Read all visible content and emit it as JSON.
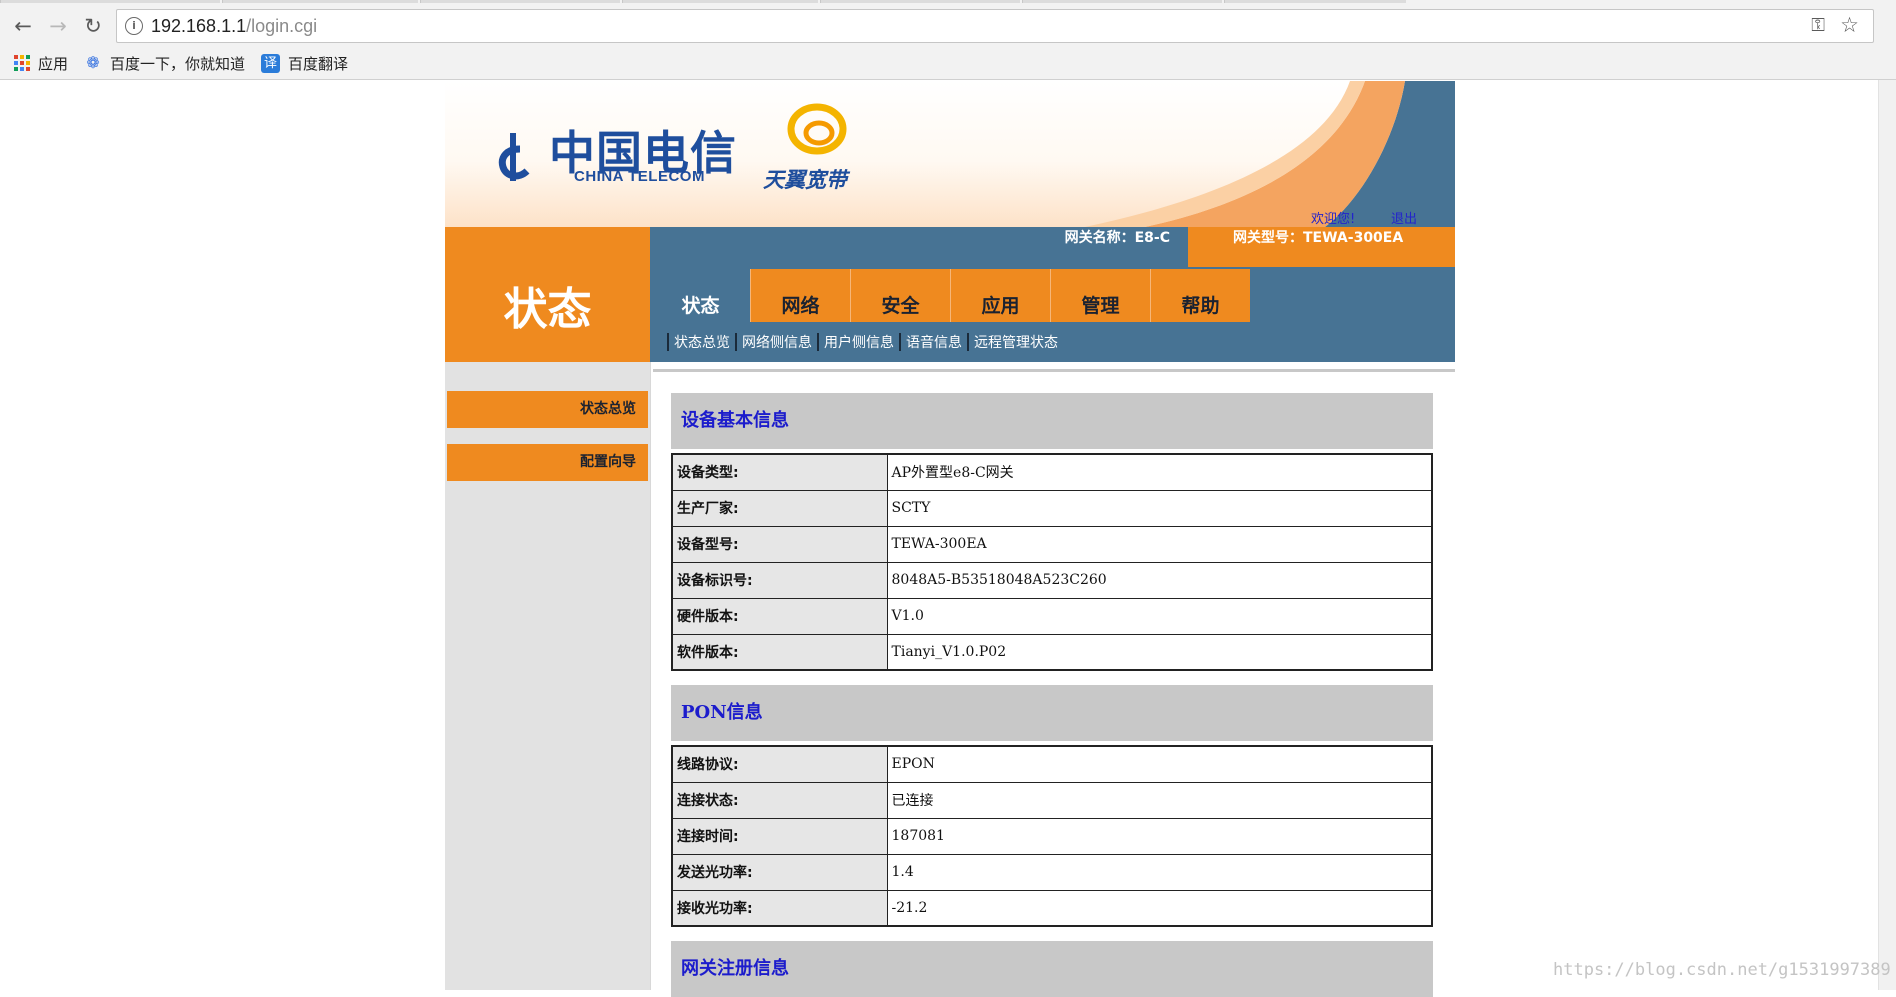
{
  "browser": {
    "url_host": "192.168.1.1",
    "url_path": "/login.cgi",
    "bookmarks": [
      {
        "label": "应用",
        "icon": "apps-grid-icon"
      },
      {
        "label": "百度一下，你就知道",
        "icon": "baidu-paw-icon"
      },
      {
        "label": "百度翻译",
        "icon": "translate-icon",
        "icon_text": "译"
      }
    ]
  },
  "header": {
    "logo_cn": "中国电信",
    "logo_en": "CHINA TELECOM",
    "product": "天翼宽带",
    "welcome": "欢迎您!",
    "logout": "退出",
    "gateway_name": "网关名称：E8-C",
    "gateway_model": "网关型号：TEWA-300EA",
    "page_title": "状态"
  },
  "tabs": [
    "状态",
    "网络",
    "安全",
    "应用",
    "管理",
    "帮助"
  ],
  "subnav": [
    "状态总览",
    "网络侧信息",
    "用户侧信息",
    "语音信息",
    "远程管理状态"
  ],
  "sidebar": [
    "状态总览",
    "配置向导"
  ],
  "sections": [
    {
      "title": "设备基本信息",
      "rows": [
        {
          "label": "设备类型:",
          "value": "AP外置型e8-C网关"
        },
        {
          "label": "生产厂家:",
          "value": "SCTY"
        },
        {
          "label": "设备型号:",
          "value": "TEWA-300EA"
        },
        {
          "label": "设备标识号:",
          "value": "8048A5-B53518048A523C260"
        },
        {
          "label": "硬件版本:",
          "value": "V1.0"
        },
        {
          "label": "软件版本:",
          "value": "Tianyi_V1.0.P02"
        }
      ]
    },
    {
      "title": "PON信息",
      "rows": [
        {
          "label": "线路协议:",
          "value": "EPON"
        },
        {
          "label": "连接状态:",
          "value": "已连接"
        },
        {
          "label": "连接时间:",
          "value": "187081"
        },
        {
          "label": "发送光功率:",
          "value": "1.4"
        },
        {
          "label": "接收光功率:",
          "value": "-21.2"
        }
      ]
    },
    {
      "title": "网关注册信息",
      "rows": []
    }
  ],
  "watermark": "https://blog.csdn.net/g1531997389",
  "colors": {
    "orange": "#ef8a1f",
    "steel_blue": "#477394",
    "link_blue": "#2323cc",
    "section_title": "#1c1ccc"
  }
}
